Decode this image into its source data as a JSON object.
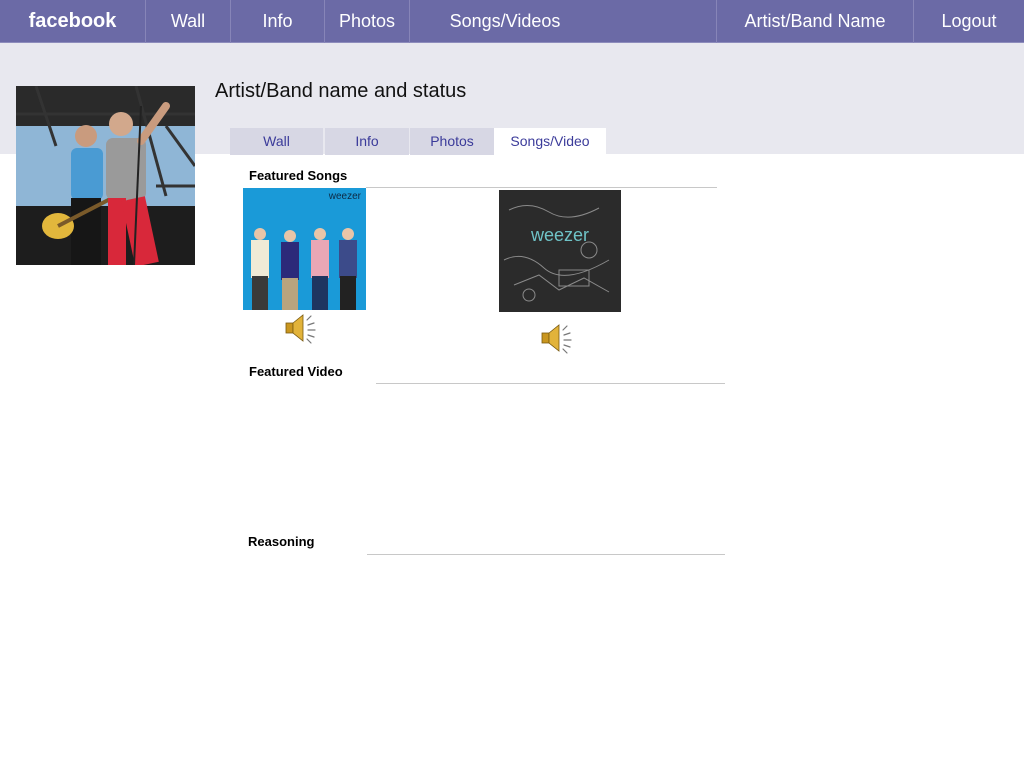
{
  "nav": {
    "brand": "facebook",
    "items": [
      "Wall",
      "Info",
      "Photos",
      "Songs/Videos"
    ],
    "user": "Artist/Band Name",
    "logout": "Logout"
  },
  "profile": {
    "title": "Artist/Band name and status"
  },
  "tabs": [
    {
      "label": "Wall",
      "active": false
    },
    {
      "label": "Info",
      "active": false
    },
    {
      "label": "Photos",
      "active": false
    },
    {
      "label": "Songs/Video",
      "active": true
    }
  ],
  "sections": {
    "featured_songs": "Featured Songs",
    "featured_video": "Featured Video",
    "reasoning": "Reasoning"
  },
  "albums": [
    {
      "cover_text": "weezer",
      "icon": "speaker-icon"
    },
    {
      "cover_text": "weezer",
      "icon": "speaker-icon"
    }
  ],
  "colors": {
    "nav_bg": "#6b6aa6",
    "band_bg": "#e8e8ef",
    "tab_text": "#3b3b9a",
    "album1_bg": "#1a9ad8",
    "album2_bg": "#2b2b2b"
  }
}
